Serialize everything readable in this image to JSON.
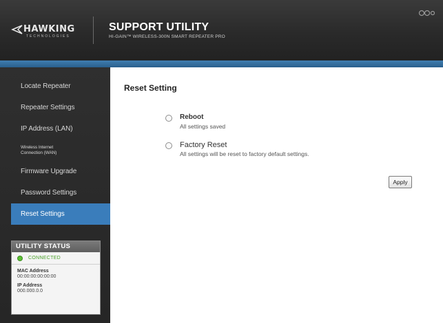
{
  "header": {
    "logo_text": "HAWKING",
    "logo_sub": "TECHNOLOGIES",
    "title": "SUPPORT UTILITY",
    "subtitle": "HI-GAIN™ WIRELESS-300N SMART REPEATER PRO"
  },
  "sidebar": {
    "items": [
      {
        "label": "Locate Repeater"
      },
      {
        "label": "Repeater Settings"
      },
      {
        "label": "IP Address (LAN)"
      },
      {
        "label": "Wireless Internet Connection (WAN)"
      },
      {
        "label": "Firmware Upgrade"
      },
      {
        "label": "Password Settings"
      },
      {
        "label": "Reset Settings",
        "active": true
      }
    ]
  },
  "status": {
    "title": "UTILITY STATUS",
    "connection": "CONNECTED",
    "mac_label": "MAC Address",
    "mac_value": "00:00:00:00:00:00",
    "ip_label": "IP Address",
    "ip_value": "000.000.0.0"
  },
  "main": {
    "title": "Reset Setting",
    "options": [
      {
        "label": "Reboot",
        "description": "All settings saved"
      },
      {
        "label": "Factory Reset",
        "description": "All settings will be reset to factory default settings."
      }
    ],
    "apply_label": "Apply"
  },
  "colors": {
    "accent": "#3a7dbb",
    "header_bg": "#2a2a2a",
    "connected": "#5cc135"
  },
  "icons": {
    "logo": "hawking-logo-icon",
    "header_controls": "window-controls-icon",
    "status": "status-dot-icon"
  }
}
